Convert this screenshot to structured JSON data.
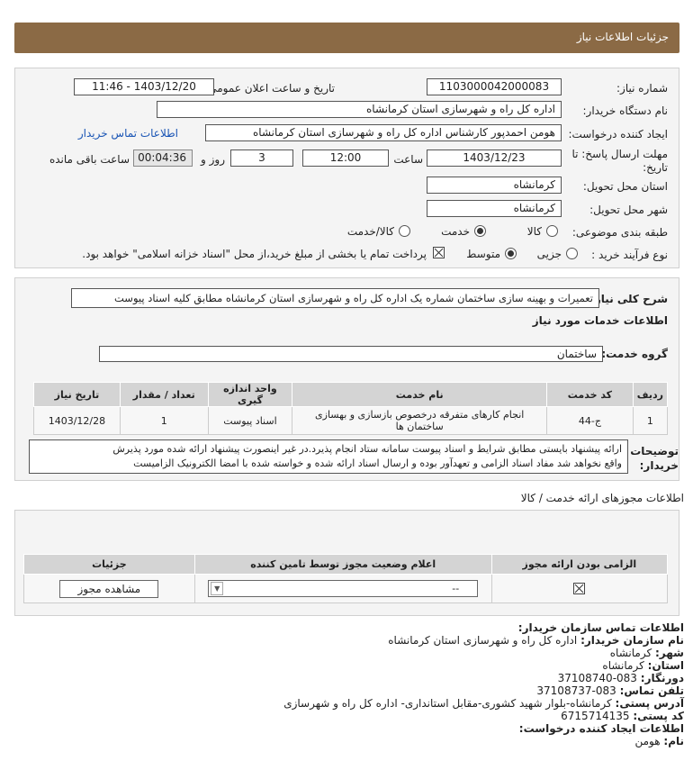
{
  "header": {
    "title": "جزئیات اطلاعات نیاز"
  },
  "form": {
    "need_number_label": "شماره نیاز:",
    "need_number": "1103000042000083",
    "announce_label": "تاریخ و ساعت اعلان عمومی:",
    "announce_value": "1403/12/20 - 11:46",
    "buyer_org_label": "نام دستگاه خریدار:",
    "buyer_org": "اداره کل راه و شهرسازی استان کرمانشاه",
    "creator_label": "ایجاد کننده درخواست:",
    "creator": "هومن احمدپور کارشناس اداره کل راه و شهرسازی استان کرمانشاه",
    "contact_link": "اطلاعات تماس خریدار",
    "deadline_label_1": "مهلت ارسال پاسخ: تا",
    "deadline_label_2": "تاریخ:",
    "deadline_date": "1403/12/23",
    "time_label": "ساعت",
    "deadline_time": "12:00",
    "days_value": "3",
    "days_label": "روز و",
    "remaining_time": "00:04:36",
    "remaining_label": "ساعت باقی مانده",
    "province_label": "استان محل تحویل:",
    "province": "کرمانشاه",
    "city_label": "شهر محل تحویل:",
    "city": "کرمانشاه",
    "category_label": "طبقه بندی موضوعی:",
    "category_options": [
      "کالا",
      "خدمت",
      "کالا/خدمت"
    ],
    "category_selected": "خدمت",
    "process_label": "نوع فرآیند خرید :",
    "process_options": [
      "جزیی",
      "متوسط"
    ],
    "process_selected": "متوسط",
    "payment_note": "پرداخت تمام یا بخشی از مبلغ خرید،از محل \"اسناد خزانه اسلامی\" خواهد بود."
  },
  "summary": {
    "label": "شرح کلی نیاز:",
    "text": "تعمیرات و بهینه سازی ساختمان شماره یک اداره کل راه و شهرسازی استان کرمانشاه مطابق کلیه اسناد پیوست"
  },
  "services": {
    "section_title": "اطلاعات خدمات مورد نیاز",
    "group_label": "گروه خدمت:",
    "group_value": "ساختمان",
    "columns": [
      "ردیف",
      "کد خدمت",
      "نام خدمت",
      "واحد اندازه گیری",
      "تعداد / مقدار",
      "تاریخ نیاز"
    ],
    "rows": [
      {
        "row": "1",
        "code": "ج-44",
        "name": "انجام کارهای متفرقه درخصوص بازسازی و بهسازی ساختمان ها",
        "unit": "اسناد پیوست",
        "qty": "1",
        "date": "1403/12/28"
      }
    ]
  },
  "buyer_notes": {
    "label_1": "توضیحات",
    "label_2": "خریدار:",
    "line1": "ارائه پیشنهاد بایستی مطابق شرایط و اسناد پیوست سامانه ستاد انجام پذیرد.در غیر اینصورت پیشنهاد ارائه شده مورد پذیرش",
    "line2": "واقع نخواهد شد مفاد اسناد الزامی و تعهدآور بوده و ارسال اسناد ارائه شده و خواسته شده با امضا الکترونیک الزامیست"
  },
  "permits": {
    "section_title": "اطلاعات مجوزهای ارائه خدمت / کالا",
    "columns": [
      "الزامی بودن ارائه مجوز",
      "اعلام وضعیت مجوز توسط تامین کننده",
      "جزئیات"
    ],
    "status_value": "--",
    "view_button": "مشاهده مجوز"
  },
  "contact": {
    "title": "اطلاعات تماس سازمان خریدار:",
    "org_label": "نام سازمان خریدار:",
    "org_value": "اداره کل راه و شهرسازی استان کرمانشاه",
    "city_label": "شهر:",
    "city_value": "کرمانشاه",
    "province_label": "استان:",
    "province_value": "کرمانشاه",
    "fax_label": "دورنگار:",
    "fax_value": "083-37108740",
    "phone_label": "تلفن تماس:",
    "phone_value": "083-37108737",
    "address_label": "آدرس پستی:",
    "address_value": "کرمانشاه-بلوار شهید کشوری-مقابل استانداری- اداره کل راه و شهرسازی",
    "postal_label": "کد پستی:",
    "postal_value": "6715714135",
    "creator_title": "اطلاعات ایجاد کننده درخواست:",
    "name_label": "نام:",
    "name_value": "هومن"
  },
  "colors": {
    "header_bg": "#8b6a45",
    "link": "#1a55b5"
  }
}
